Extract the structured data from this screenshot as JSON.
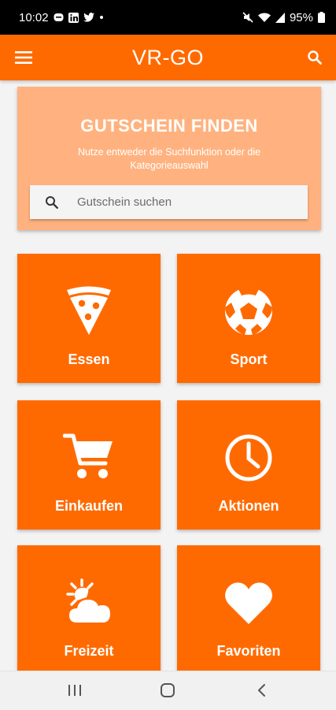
{
  "status_bar": {
    "time": "10:02",
    "left_icons": [
      "message-icon",
      "linkedin-icon",
      "twitter-icon",
      "dot-icon"
    ],
    "battery": "95%",
    "right_icons": [
      "mute-icon",
      "wifi-icon",
      "signal-icon",
      "battery-icon"
    ]
  },
  "app_bar": {
    "title": "VR-GO",
    "menu_icon": "hamburger-menu-icon",
    "search_icon": "search-icon",
    "color": "#ff6a00"
  },
  "hero": {
    "title": "GUTSCHEIN FINDEN",
    "subtitle": "Nutze entweder die Suchfunktion oder die Kategorieauswahl",
    "search_placeholder": "Gutschein suchen",
    "search_value": "",
    "color": "#ffb27f"
  },
  "categories": [
    {
      "label": "Essen",
      "icon": "pizza-icon"
    },
    {
      "label": "Sport",
      "icon": "soccer-ball-icon"
    },
    {
      "label": "Einkaufen",
      "icon": "shopping-cart-icon"
    },
    {
      "label": "Aktionen",
      "icon": "clock-icon"
    },
    {
      "label": "Freizeit",
      "icon": "sun-cloud-icon"
    },
    {
      "label": "Favoriten",
      "icon": "heart-icon"
    }
  ],
  "nav_bar": {
    "buttons": [
      "recent-apps-icon",
      "home-icon",
      "back-icon"
    ]
  }
}
